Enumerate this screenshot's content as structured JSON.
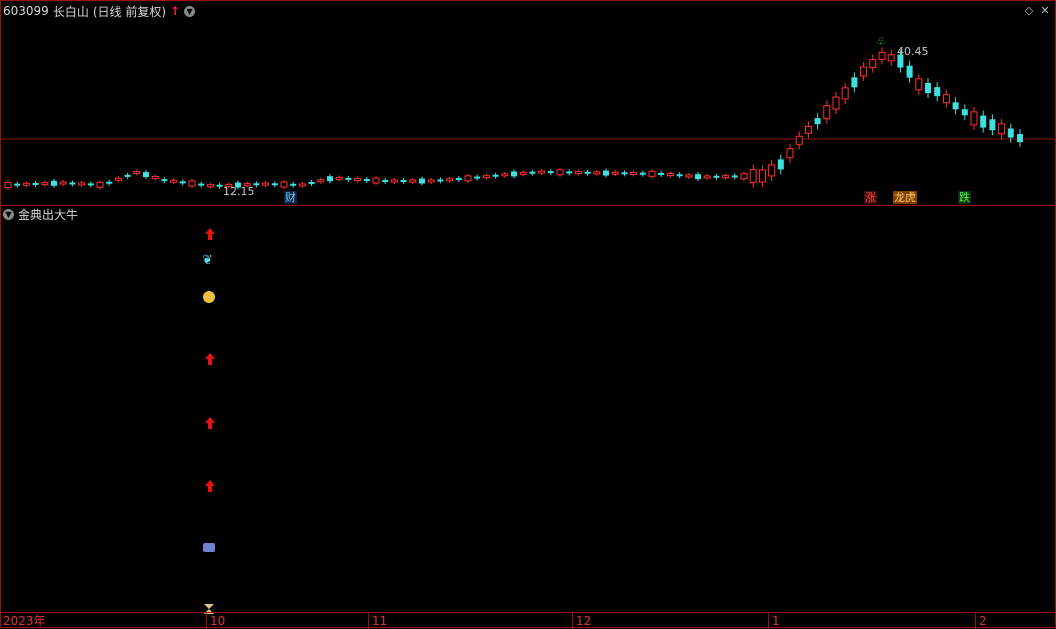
{
  "header": {
    "code": "603099",
    "name": "长白山",
    "period": "(日线 前复权)",
    "up_arrow": "↑",
    "dropdown_icon": "chevron-down-icon"
  },
  "price_labels": {
    "high": "40.45",
    "low": "12.15"
  },
  "events": {
    "cai": "财",
    "zhang": "涨",
    "longhu": "龙虎",
    "die": "跌"
  },
  "indicator": {
    "name": "金典出大牛"
  },
  "axis": {
    "labels": [
      "2023年",
      "10",
      "11",
      "12",
      "1",
      "2"
    ]
  },
  "colors": {
    "up": "#ff3030",
    "down": "#40e0e0",
    "grid": "#9a1010",
    "bg": "#000000"
  }
}
